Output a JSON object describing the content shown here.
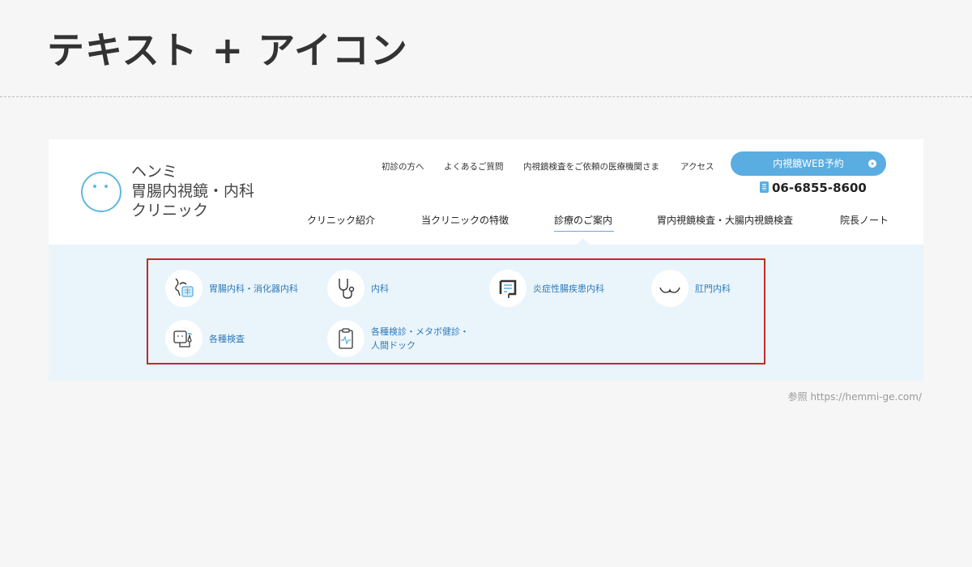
{
  "page": {
    "title": "テキスト + アイコン",
    "reference": "参照 https://hemmi-ge.com/"
  },
  "logo": {
    "line1": "ヘンミ",
    "line2": "胃腸内視鏡・内科",
    "line3": "クリニック"
  },
  "util_nav": [
    "初診の方へ",
    "よくあるご質問",
    "内視鏡検査をご依頼の医療機関さま",
    "アクセス"
  ],
  "cta": {
    "label": "内視鏡WEB予約"
  },
  "phone": "06-6855-8600",
  "main_nav": [
    "クリニック紹介",
    "当クリニックの特徴",
    "診療のご案内",
    "胃内視鏡検査・大腸内視鏡検査",
    "院長ノート"
  ],
  "active_nav": "診療のご案内",
  "dropdown": [
    {
      "label": "胃腸内科・消化器内科",
      "icon": "stomach-icon"
    },
    {
      "label": "内科",
      "icon": "stethoscope-icon"
    },
    {
      "label": "炎症性腸疾患内科",
      "icon": "intestine-icon"
    },
    {
      "label": "肛門内科",
      "icon": "buttocks-icon"
    },
    {
      "label": "各種検査",
      "icon": "ultrasound-icon"
    },
    {
      "label_line1": "各種検診・メタボ健診・",
      "label_line2": "人間ドック",
      "icon": "clipboard-icon"
    }
  ],
  "colors": {
    "accent": "#5aade1",
    "link": "#2e7ab8",
    "highlight_border": "#c62828",
    "panel_bg": "#eaf4fb"
  }
}
